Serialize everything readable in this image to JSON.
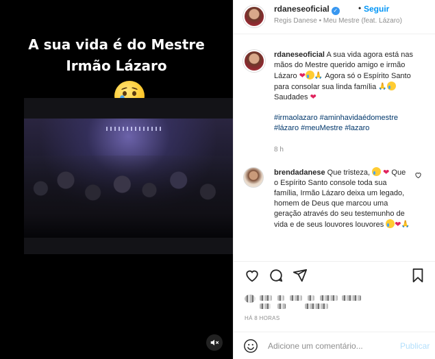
{
  "media": {
    "caption_line1": "A sua vida é do Mestre",
    "caption_line2": "Irmão Lázaro",
    "emoji": "crying-face"
  },
  "header": {
    "username": "rdaneseoficial",
    "separator": "•",
    "follow_label": "Seguir",
    "audio": "Regis Danese • Meu Mestre (feat. Lázaro)"
  },
  "caption": {
    "username": "rdaneseoficial",
    "text_part1": "A sua vida agora está nas mãos do Mestre querido amigo e irmão Lázaro",
    "text_part2": "Agora só o Espírito Santo para consolar sua linda família",
    "text_part3": "Saudades",
    "hashtags": "#irmaolazaro #aminhavidaédomestre #lázaro #meuMestre #lazaro",
    "time": "8 h"
  },
  "comment": {
    "username": "brendadanese",
    "text_part1": "Que tristeza,",
    "text_part2": "Que o Espírito Santo console toda sua família, Irmão Lázaro deixa um legado, homem de Deus que marcou uma geração através do seu testemunho de vida e de seus louvores louvores"
  },
  "footer": {
    "posted_time": "HÁ 8 HORAS",
    "comment_placeholder": "Adicione um comentário...",
    "publish_label": "Publicar"
  },
  "colors": {
    "accent": "#0095f6",
    "publish_disabled": "#b2dffc",
    "heart": "#e0245e"
  }
}
